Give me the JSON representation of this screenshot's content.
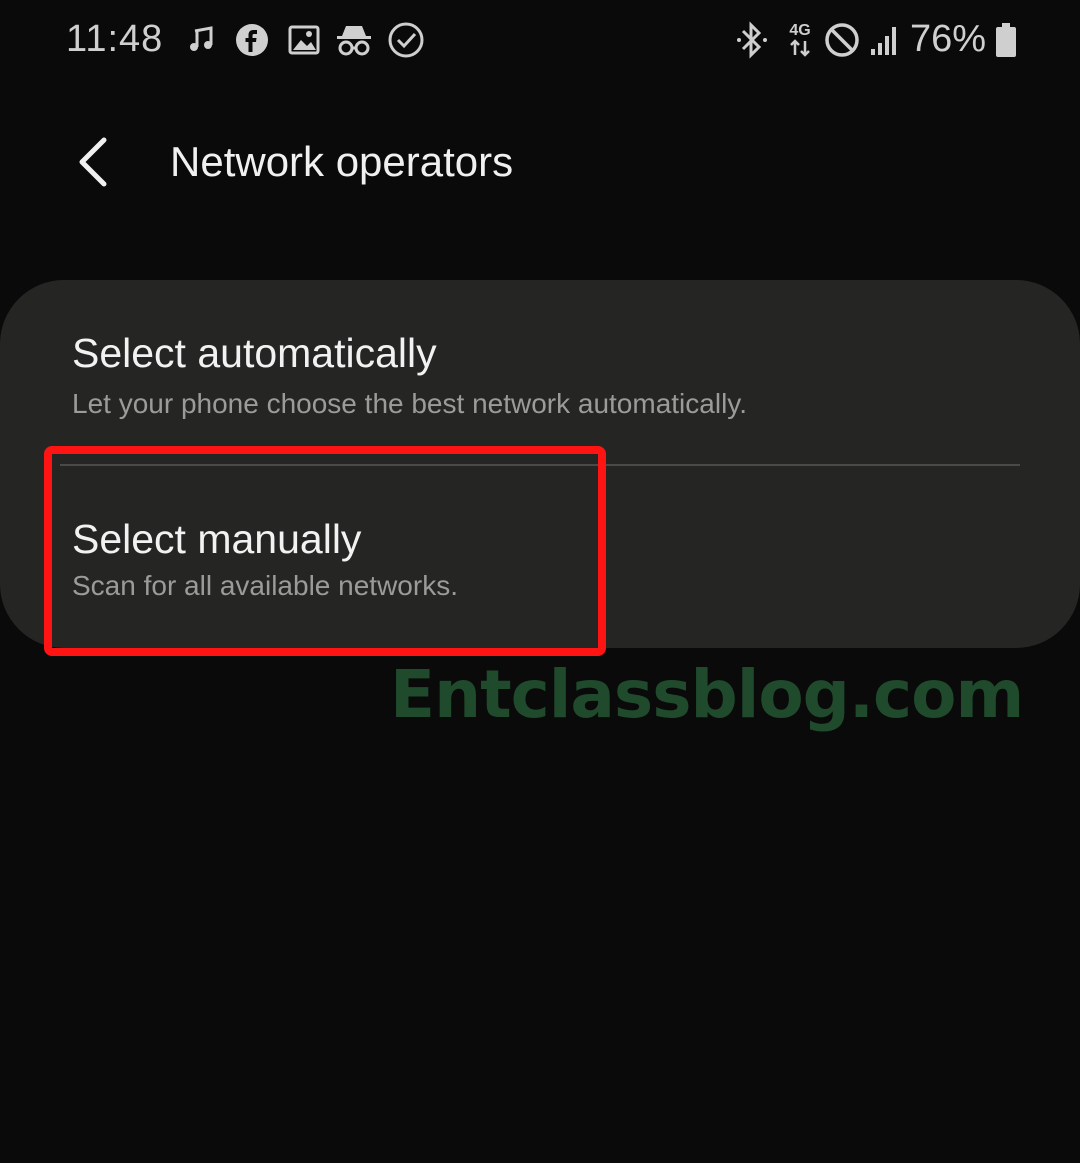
{
  "status_bar": {
    "time": "11:48",
    "battery_percent": "76%",
    "network_type": "4G",
    "left_icons": [
      "music-note-icon",
      "facebook-icon",
      "gallery-icon",
      "incognito-icon",
      "check-circle-icon"
    ],
    "right_icons": [
      "bluetooth-icon",
      "data-4g-icon",
      "do-not-disturb-icon",
      "signal-icon",
      "battery-icon"
    ]
  },
  "header": {
    "title": "Network operators",
    "back_icon": "chevron-left-icon"
  },
  "options": [
    {
      "title": "Select automatically",
      "subtitle": "Let your phone choose the best network automatically."
    },
    {
      "title": "Select manually",
      "subtitle": "Scan for all available networks."
    }
  ],
  "highlight": {
    "target": "Select manually",
    "color": "#ff1414"
  },
  "watermark": {
    "text": "Entclassblog.com",
    "color": "#1f4a2c"
  },
  "colors": {
    "background": "#0a0a0a",
    "card": "#252623",
    "text_primary": "#f2f2f2",
    "text_secondary": "#9b9b99"
  }
}
